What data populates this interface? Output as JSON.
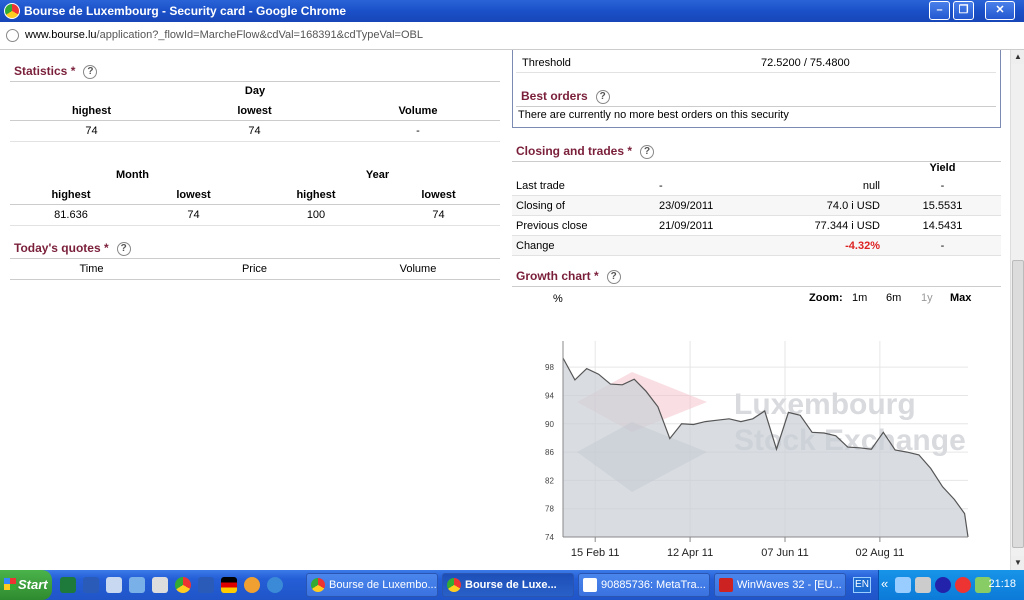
{
  "window": {
    "title": "Bourse de Luxembourg - Security card - Google Chrome"
  },
  "browser": {
    "url_host": "www.bourse.lu",
    "url_path": "/application?_flowId=MarcheFlow&cdVal=168391&cdTypeVal=OBL"
  },
  "statistics": {
    "title": "Statistics",
    "star": "*",
    "help": "?",
    "day": {
      "label": "Day",
      "highest_h": "highest",
      "lowest_h": "lowest",
      "volume_h": "Volume",
      "highest": "74",
      "lowest": "74",
      "volume": "-"
    },
    "month": {
      "label": "Month",
      "highest_h": "highest",
      "lowest_h": "lowest",
      "highest": "81.636",
      "lowest": "74"
    },
    "year": {
      "label": "Year",
      "highest_h": "highest",
      "lowest_h": "lowest",
      "highest": "100",
      "lowest": "74"
    }
  },
  "quotes": {
    "title": "Today's quotes",
    "star": "*",
    "help": "?",
    "time_h": "Time",
    "price_h": "Price",
    "volume_h": "Volume"
  },
  "threshold": {
    "label": "Threshold",
    "value": "72.5200 / 75.4800"
  },
  "best_orders": {
    "title": "Best orders",
    "help": "?",
    "message": "There are currently no more best orders on this security"
  },
  "closing": {
    "title": "Closing and trades",
    "star": "*",
    "help": "?",
    "yield_h": "Yield",
    "rows": [
      {
        "label": "Last trade",
        "date": "-",
        "price": "null",
        "yield": "-"
      },
      {
        "label": "Closing of",
        "date": "23/09/2011",
        "price": "74.0 i USD",
        "yield": "15.5531"
      },
      {
        "label": "Previous close",
        "date": "21/09/2011",
        "price": "77.344 i USD",
        "yield": "14.5431"
      },
      {
        "label": "Change",
        "date": "",
        "price": "-4.32%",
        "yield": "-"
      }
    ]
  },
  "growth": {
    "title": "Growth chart",
    "star": "*",
    "help": "?",
    "zoom_label": "Zoom:",
    "zoom": [
      "1m",
      "6m",
      "1y",
      "Max"
    ],
    "watermark_1": "Luxembourg",
    "watermark_2": "Stock Exchange"
  },
  "chart_data": {
    "type": "area",
    "ylabel": "%",
    "ylim": [
      74,
      100
    ],
    "yticks": [
      74,
      78,
      82,
      86,
      90,
      94,
      98
    ],
    "xticks": [
      "15 Feb 11",
      "12 Apr 11",
      "07 Jun 11",
      "02 Aug 11"
    ],
    "series": [
      {
        "x": [
          "2011-01-27",
          "2011-02-03",
          "2011-02-10",
          "2011-02-17",
          "2011-02-24",
          "2011-03-03",
          "2011-03-10",
          "2011-03-17",
          "2011-03-24",
          "2011-03-31",
          "2011-04-07",
          "2011-04-14",
          "2011-04-21",
          "2011-04-28",
          "2011-05-05",
          "2011-05-12",
          "2011-05-19",
          "2011-05-26",
          "2011-06-02",
          "2011-06-09",
          "2011-06-16",
          "2011-06-23",
          "2011-06-30",
          "2011-07-07",
          "2011-07-14",
          "2011-07-21",
          "2011-07-28",
          "2011-08-04",
          "2011-08-11",
          "2011-08-18",
          "2011-08-25",
          "2011-09-01",
          "2011-09-08",
          "2011-09-15",
          "2011-09-21",
          "2011-09-23"
        ],
        "values": [
          99.3,
          96.2,
          97.8,
          97.0,
          95.6,
          95.5,
          96.3,
          94.6,
          92.4,
          87.9,
          90.0,
          89.9,
          90.3,
          90.5,
          90.7,
          90.3,
          90.7,
          91.8,
          86.4,
          91.6,
          91.2,
          88.8,
          88.7,
          88.3,
          86.7,
          86.6,
          86.4,
          88.8,
          86.3,
          86.0,
          85.6,
          83.7,
          81.1,
          79.3,
          77.3,
          74.0
        ]
      }
    ]
  },
  "taskbar": {
    "start": "Start",
    "tasks": [
      "Bourse de Luxembo...",
      "Bourse de Luxe...",
      "90885736: MetaTra...",
      "WinWaves 32 - [EU..."
    ],
    "lang": "EN",
    "chev": "«",
    "clock": "21:18"
  }
}
